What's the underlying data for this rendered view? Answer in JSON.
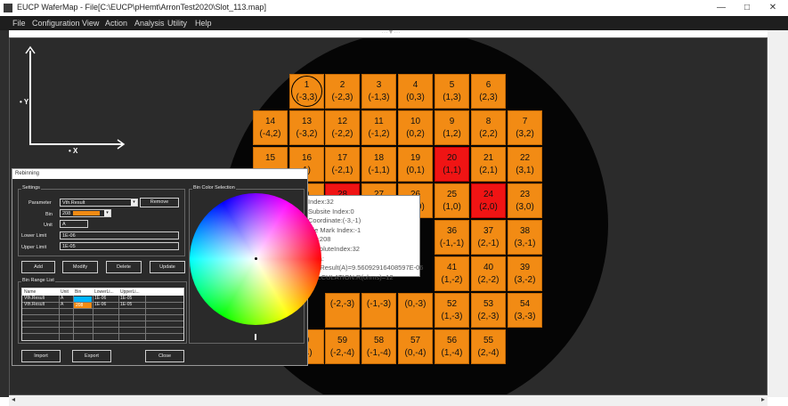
{
  "window": {
    "title": "EUCP WaferMap - File[C:\\EUCP\\pHemt\\ArronTest2020\\Slot_113.map]"
  },
  "window_controls": {
    "minimize": "—",
    "maximize": "□",
    "close": "✕"
  },
  "menu": [
    "File",
    "Configuration",
    "View",
    "Action",
    "Analysis",
    "Utility",
    "Help"
  ],
  "axes": {
    "x_label": "• X",
    "y_label": "• Y"
  },
  "colors": {
    "die": "#f28b14",
    "die_selected": "#f01414",
    "wafer": "#050505",
    "bin_a": "#00b4ff",
    "bin_208": "#f28b14"
  },
  "dies": [
    {
      "idx": "1",
      "coord": "(-3,3)",
      "state": "selected"
    },
    {
      "idx": "2",
      "coord": "(-2,3)",
      "state": "normal"
    },
    {
      "idx": "3",
      "coord": "(-1,3)",
      "state": "normal"
    },
    {
      "idx": "4",
      "coord": "(0,3)",
      "state": "normal"
    },
    {
      "idx": "5",
      "coord": "(1,3)",
      "state": "normal"
    },
    {
      "idx": "6",
      "coord": "(2,3)",
      "state": "normal"
    },
    {
      "idx": "14",
      "coord": "(-4,2)",
      "state": "normal"
    },
    {
      "idx": "13",
      "coord": "(-3,2)",
      "state": "normal"
    },
    {
      "idx": "12",
      "coord": "(-2,2)",
      "state": "normal"
    },
    {
      "idx": "11",
      "coord": "(-1,2)",
      "state": "normal"
    },
    {
      "idx": "10",
      "coord": "(0,2)",
      "state": "normal"
    },
    {
      "idx": "9",
      "coord": "(1,2)",
      "state": "normal"
    },
    {
      "idx": "8",
      "coord": "(2,2)",
      "state": "normal"
    },
    {
      "idx": "7",
      "coord": "(3,2)",
      "state": "normal"
    },
    {
      "idx": "15",
      "coord": "",
      "state": "normal"
    },
    {
      "idx": "16",
      "coord": "1)",
      "state": "normal"
    },
    {
      "idx": "17",
      "coord": "(-2,1)",
      "state": "normal"
    },
    {
      "idx": "18",
      "coord": "(-1,1)",
      "state": "normal"
    },
    {
      "idx": "19",
      "coord": "(0,1)",
      "state": "normal"
    },
    {
      "idx": "20",
      "coord": "(1,1)",
      "state": "red"
    },
    {
      "idx": "21",
      "coord": "(2,1)",
      "state": "normal"
    },
    {
      "idx": "22",
      "coord": "(3,1)",
      "state": "normal"
    },
    {
      "idx": "9",
      "coord": ",0)",
      "state": "normal"
    },
    {
      "idx": "28",
      "coord": "(-2,0)",
      "state": "red"
    },
    {
      "idx": "27",
      "coord": "(-1,0)",
      "state": "normal"
    },
    {
      "idx": "26",
      "coord": "(0,0)",
      "state": "normal"
    },
    {
      "idx": "25",
      "coord": "(1,0)",
      "state": "normal"
    },
    {
      "idx": "24",
      "coord": "(2,0)",
      "state": "red"
    },
    {
      "idx": "23",
      "coord": "(3,0)",
      "state": "normal"
    },
    {
      "idx": "36",
      "coord": "(-1,-1)",
      "state": "normal"
    },
    {
      "idx": "37",
      "coord": "(2,-1)",
      "state": "normal"
    },
    {
      "idx": "38",
      "coord": "(3,-1)",
      "state": "normal"
    },
    {
      "idx": "41",
      "coord": "(1,-2)",
      "state": "normal"
    },
    {
      "idx": "40",
      "coord": "(2,-2)",
      "state": "normal"
    },
    {
      "idx": "39",
      "coord": "(3,-2)",
      "state": "normal"
    },
    {
      "idx": "",
      "coord": "(-2,-3)",
      "state": "normal"
    },
    {
      "idx": "",
      "coord": "(-1,-3)",
      "state": "normal"
    },
    {
      "idx": "",
      "coord": "(0,-3)",
      "state": "normal"
    },
    {
      "idx": "52",
      "coord": "(1,-3)",
      "state": "normal"
    },
    {
      "idx": "53",
      "coord": "(2,-3)",
      "state": "normal"
    },
    {
      "idx": "54",
      "coord": "(3,-3)",
      "state": "normal"
    },
    {
      "idx": "0",
      "coord": "-4)",
      "state": "normal"
    },
    {
      "idx": "59",
      "coord": "(-2,-4)",
      "state": "normal"
    },
    {
      "idx": "58",
      "coord": "(-1,-4)",
      "state": "normal"
    },
    {
      "idx": "57",
      "coord": "(0,-4)",
      "state": "normal"
    },
    {
      "idx": "56",
      "coord": "(1,-4)",
      "state": "normal"
    },
    {
      "idx": "55",
      "coord": "(2,-4)",
      "state": "normal"
    }
  ],
  "tooltip": {
    "lines": [
      "Index:32",
      "Subsite Index:0",
      "Coordinate:(-3,-1)",
      "Die Mark Index:-1",
      "Bin:208",
      "AbsoluteIndex:32",
      "Data:",
      "Vth.Result(A)=9.56092916408597E-06",
      "CALCULATION.R(ohms)=12"
    ]
  },
  "dialog": {
    "title": "Rebinning",
    "settings": {
      "group_label": "Settings",
      "parameter_label": "Parameter",
      "parameter_value": "Vth.Result",
      "remove_button": "Remove",
      "bin_label": "Bin",
      "bin_value": "208",
      "unit_label": "Unit",
      "unit_value": "A",
      "lower_label": "Lower Limit",
      "lower_value": "1E-06",
      "upper_label": "Upper Limit",
      "upper_value": "1E-05"
    },
    "buttons": {
      "add": "Add",
      "modify": "Modify",
      "delete": "Delete",
      "update": "Update",
      "import": "Import",
      "export": "Export",
      "close": "Close"
    },
    "bin_range_list": {
      "group_label": "Bin Range List",
      "columns": [
        "Name",
        "Unit",
        "Bin",
        "LowerLi...",
        "UpperLi..."
      ],
      "rows": [
        {
          "name": "Vth.Result",
          "unit": "A",
          "bin": "",
          "lower": "1E-06",
          "upper": "1E-05",
          "bin_color": "#00b4ff"
        },
        {
          "name": "Vth.Result",
          "unit": "A",
          "bin": "208",
          "lower": "1E-06",
          "upper": "1E-05",
          "bin_color": "#f28b14"
        }
      ]
    },
    "color_selection": {
      "group_label": "Bin Color Selection"
    }
  }
}
